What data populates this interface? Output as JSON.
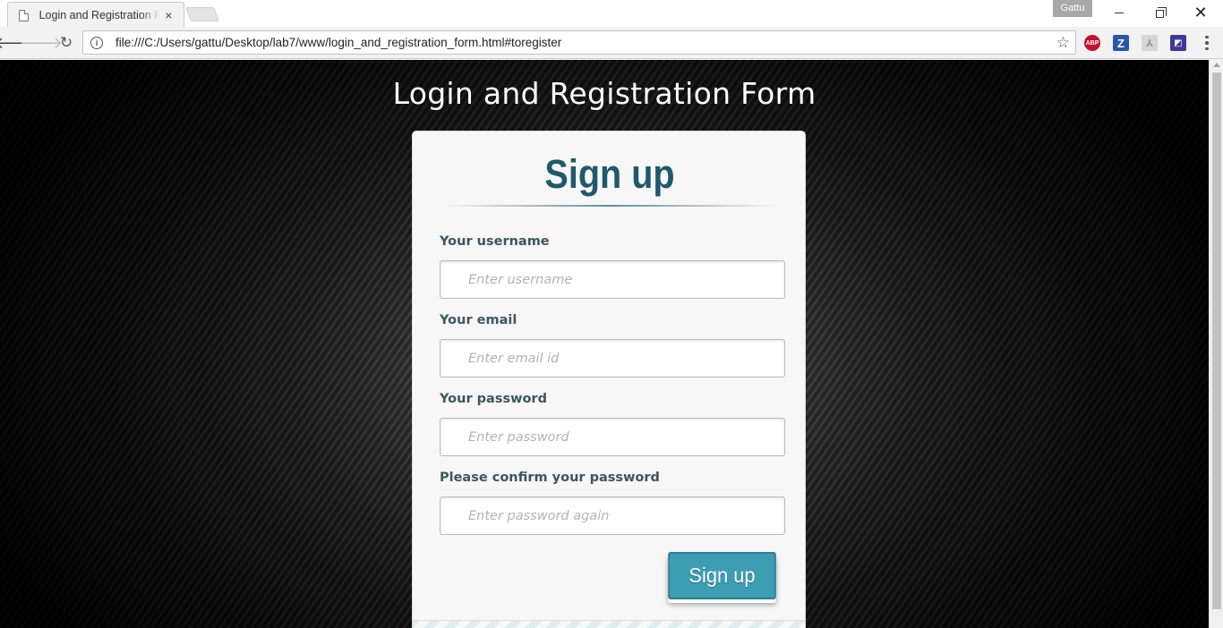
{
  "browser": {
    "tab_title": "Login and Registration Form",
    "tab_close_glyph": "×",
    "profile_name": "Gattu",
    "url": "file:///C:/Users/gattu/Desktop/lab7/www/login_and_registration_form.html#toregister",
    "icons": {
      "back": "back-arrow-icon",
      "forward": "forward-arrow-icon",
      "reload": "reload-icon",
      "info": "info-icon",
      "star": "bookmark-star-icon",
      "menu": "menu-dots-icon"
    },
    "extensions": [
      {
        "name": "adblock-plus-icon",
        "label": "ABP"
      },
      {
        "name": "zotero-icon",
        "label": "Z"
      },
      {
        "name": "pdf-icon",
        "label": ""
      },
      {
        "name": "document-extension-icon",
        "label": ""
      }
    ]
  },
  "page": {
    "heading": "Login and Registration Form",
    "colors": {
      "accent": "#3d9db3",
      "title": "#1e5a6a",
      "label": "#3b5661",
      "background": "#000000"
    },
    "form": {
      "title": "Sign up",
      "fields": [
        {
          "label": "Your username",
          "placeholder": "Enter username",
          "value": ""
        },
        {
          "label": "Your email",
          "placeholder": "Enter email id",
          "value": ""
        },
        {
          "label": "Your password",
          "placeholder": "Enter password",
          "value": ""
        },
        {
          "label": "Please confirm your password",
          "placeholder": "Enter password again",
          "value": ""
        }
      ],
      "submit_label": "Sign up"
    }
  }
}
